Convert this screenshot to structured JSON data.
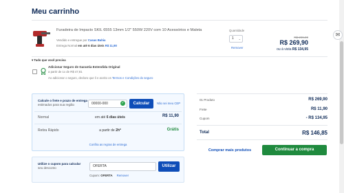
{
  "page_title": "Meu carrinho",
  "product": {
    "name": "Furadeira de Impacto SKIL 6555 13mm 1/2\" 550W 220V com 10 Acessórios e Maleta",
    "sold_by_prefix": "Vendido e entregue por",
    "seller": "Casas Bahia",
    "delivery_prefix": "Entrega Normal",
    "delivery_time": "em até 6 dias úteis",
    "delivery_price": "R$ 11,90",
    "quantity_label": "Quantidade",
    "quantity_value": "1",
    "remove_label": "Remover",
    "old_price": "R$ 299,90",
    "price": "R$ 269,90",
    "cash_prefix": "ou à vista",
    "cash_price": "R$ 134,95"
  },
  "extras": {
    "heading": "Tudo que você precisa",
    "insurance_title": "Adicionar Seguro de Garantia Estendida Original",
    "insurance_price": "a partir de 1x de R$ 47,81",
    "legal_text": "Ao adicionar o seguro, declaro que li e aceito os",
    "legal_link": "Termos e Condições do seguro"
  },
  "shipping": {
    "label_title": "Calcule o frete e prazo de entrega",
    "label_sub": "estimados para sua região",
    "cep_value": "00000-000",
    "calc_button": "Calcular",
    "no_cep_link": "Não sei meu CEP",
    "options": [
      {
        "name": "Normal",
        "time_prefix": "em até",
        "time": "6 dias úteis",
        "price": "R$ 11,90",
        "price_color": "#0e2a57"
      },
      {
        "name": "Retira Rápido",
        "time_prefix": "a partir de",
        "time": "2h*",
        "price": "Grátis",
        "price_color": "#1f8a3e"
      }
    ],
    "rules_link": "Confira as regras de entrega"
  },
  "coupon": {
    "label_title": "Utilize o cupom para calcular",
    "label_sub": "seu desconto",
    "input_value": "OFERTA",
    "apply_button": "Utilizar",
    "applied_prefix": "Cupom:",
    "applied_code": "OFERTA",
    "remove_label": "Remover"
  },
  "summary": {
    "rows": [
      {
        "label": "01 Produto",
        "value": "R$ 269,90",
        "color": "#0e2a57"
      },
      {
        "label": "Frete",
        "value": "R$ 11,90",
        "color": "#0e2a57"
      },
      {
        "label": "Cupom",
        "value": "- R$ 134,95",
        "color": "#0e2a57"
      }
    ],
    "total_label": "Total",
    "total_value": "R$ 146,85",
    "more_products_button": "Comprar mais produtos",
    "checkout_button": "Continuar a compra"
  }
}
